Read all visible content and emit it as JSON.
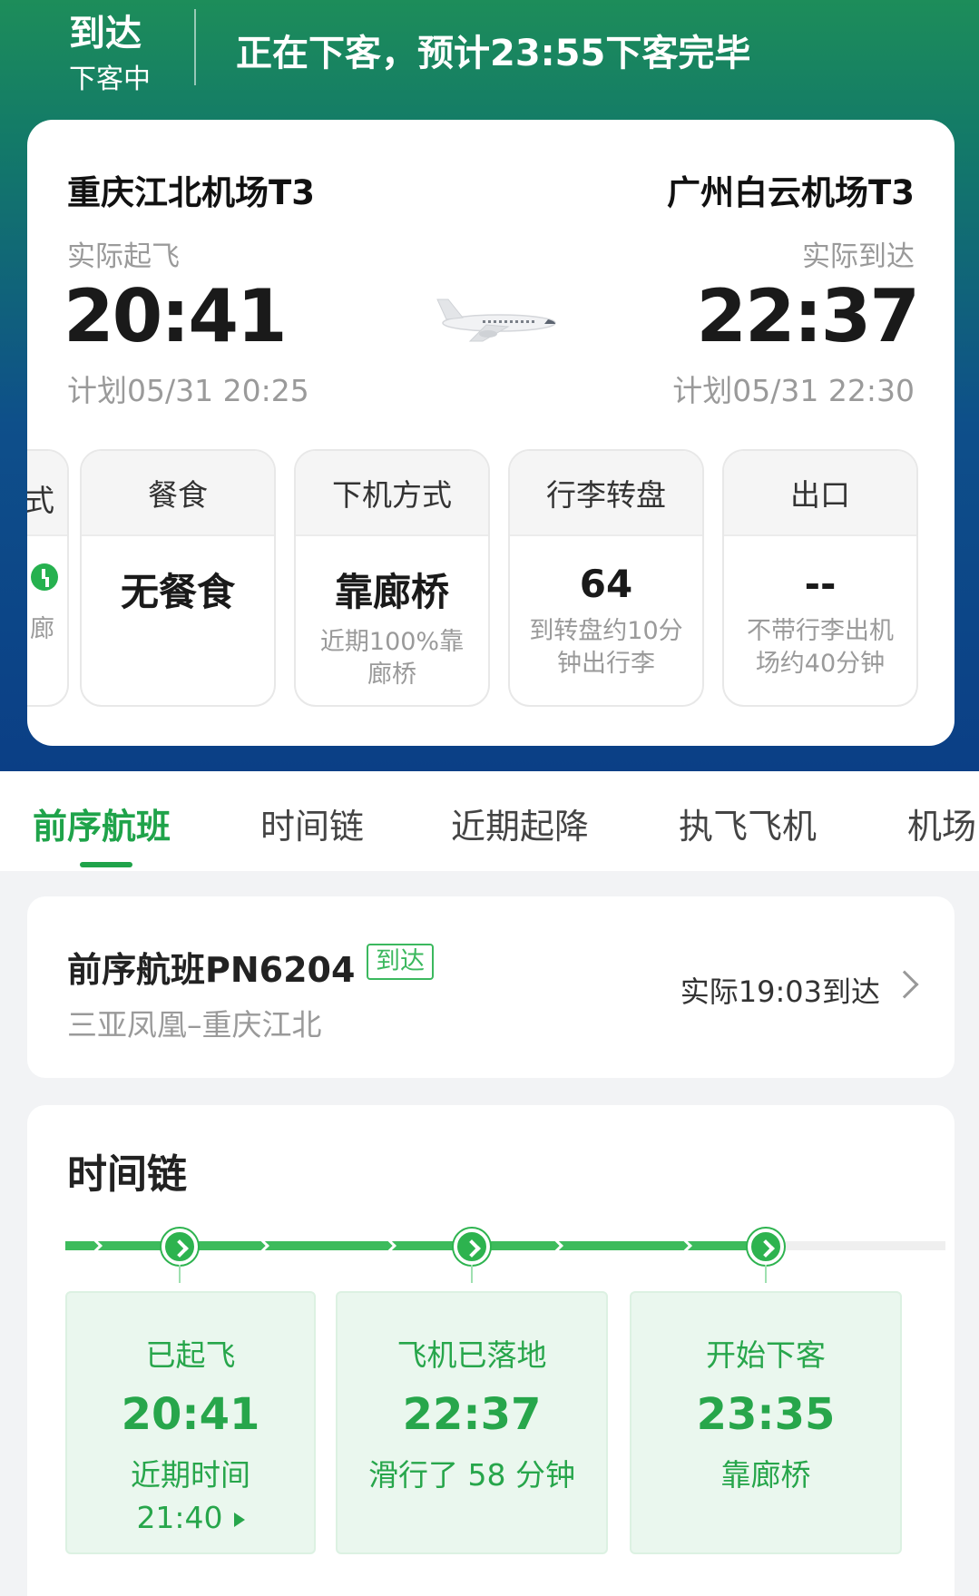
{
  "status": {
    "state": "到达",
    "sub": "下客中",
    "message": "正在下客，预计23:55下客完毕"
  },
  "flight": {
    "departure": {
      "airport": "重庆江北机场T3",
      "label": "实际起飞",
      "time": "20:41",
      "planned": "计划05/31 20:25"
    },
    "arrival": {
      "airport": "广州白云机场T3",
      "label": "实际到达",
      "time": "22:37",
      "planned": "计划05/31 22:30"
    },
    "partial_tile": {
      "head": "式",
      "sub": "廊"
    },
    "tiles": [
      {
        "head": "餐食",
        "main": "无餐食",
        "sub": ""
      },
      {
        "head": "下机方式",
        "main": "靠廊桥",
        "sub": "近期100%靠廊桥"
      },
      {
        "head": "行李转盘",
        "main": "64",
        "sub": "到转盘约10分钟出行李"
      },
      {
        "head": "出口",
        "main": "--",
        "sub": "不带行李出机场约40分钟"
      }
    ]
  },
  "tabs": [
    "前序航班",
    "时间链",
    "近期起降",
    "执飞飞机",
    "机场"
  ],
  "previous_flight": {
    "title": "前序航班PN6204",
    "badge": "到达",
    "route": "三亚凤凰–重庆江北",
    "time": "实际19:03到达"
  },
  "time_chain": {
    "title": "时间链",
    "events": [
      {
        "label": "已起飞",
        "time": "20:41",
        "sub": "近期时间",
        "sub2": "21:40"
      },
      {
        "label": "飞机已落地",
        "time": "22:37",
        "sub": "滑行了 58 分钟",
        "sub2": ""
      },
      {
        "label": "开始下客",
        "time": "23:35",
        "sub": "靠廊桥",
        "sub2": ""
      }
    ]
  },
  "colors": {
    "accent_green": "#1fa34a",
    "header_blue": "#0b3f86",
    "header_green": "#1d8d5a"
  }
}
